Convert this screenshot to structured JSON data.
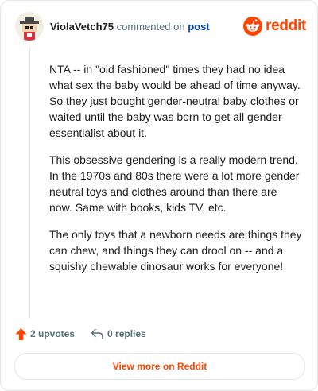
{
  "header": {
    "username": "ViolaVetch75",
    "action_text": "commented on",
    "link_text": "post",
    "brand_name": "reddit",
    "brand_color": "#ff4500",
    "avatar_icon": "snoo-avatar-icon",
    "brand_icon": "reddit-snoo-icon"
  },
  "comment": {
    "paragraphs": [
      "NTA -- in \"old fashioned\" times they had no idea what sex the baby would be ahead of time anyway. So they just bought gender-neutral baby clothes or waited until the baby was born to get all gender essentialist about it.",
      "This obsessive gendering is a really modern trend. In the 1970s and 80s there were a lot more gender neutral toys and clothes around than there are now. Same with books, kids TV, etc.",
      "The only toys that a newborn needs are things they can chew, and things they can drool on -- and a squishy chewable dinosaur works for everyone!"
    ]
  },
  "footer": {
    "upvotes": "2 upvotes",
    "replies": "0 replies",
    "upvote_icon": "upvote-arrow-icon",
    "reply_icon": "reply-arrow-icon",
    "upvote_color": "#ff4500"
  },
  "cta": {
    "label": "View more on Reddit"
  }
}
